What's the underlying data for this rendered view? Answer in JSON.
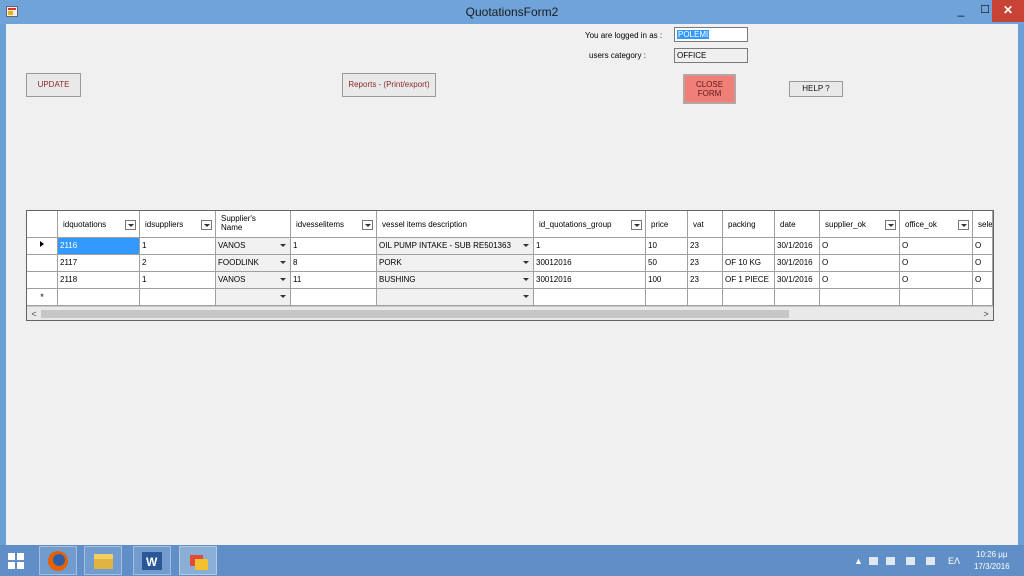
{
  "window": {
    "title": "QuotationsForm2",
    "min_symbol": "_",
    "max_symbol": "☐",
    "close_symbol": "✕"
  },
  "header": {
    "logged_label": "You are logged in as :",
    "logged_value": "POLEMI",
    "category_label": "users category :",
    "category_value": "OFFICE"
  },
  "buttons": {
    "update": "UPDATE",
    "reports": "Reports - (Print/export)",
    "close_line1": "CLOSE",
    "close_line2": "FORM",
    "help": "HELP ?"
  },
  "grid": {
    "columns": [
      "idquotations",
      "idsuppliers",
      "Supplier's Name",
      "idvesselitems",
      "vessel items  description",
      "id_quotations_group",
      "price",
      "vat",
      "packing",
      "date",
      "supplier_ok",
      "office_ok",
      "selec"
    ],
    "rows": [
      [
        "2116",
        "1",
        "VANOS",
        "1",
        "OIL PUMP INTAKE - SUB RE501363",
        "1",
        "10",
        "23",
        "",
        "30/1/2016",
        "O",
        "O",
        "O"
      ],
      [
        "2117",
        "2",
        "FOODLINK",
        "8",
        "PORK",
        "30012016",
        "50",
        "23",
        "OF 10 KG",
        "30/1/2016",
        "O",
        "O",
        "O"
      ],
      [
        "2118",
        "1",
        "VANOS",
        "11",
        "BUSHING",
        "30012016",
        "100",
        "23",
        "OF 1 PIECE",
        "30/1/2016",
        "O",
        "O",
        "O"
      ]
    ],
    "new_row_marker": "*",
    "scroll_left": "<",
    "scroll_right": ">"
  },
  "taskbar": {
    "apps": [
      "start-button",
      "firefox",
      "file-explorer",
      "word",
      "quotations-app"
    ],
    "lang": "EΛ",
    "time": "10:26 μμ",
    "date": "17/3/2016"
  }
}
